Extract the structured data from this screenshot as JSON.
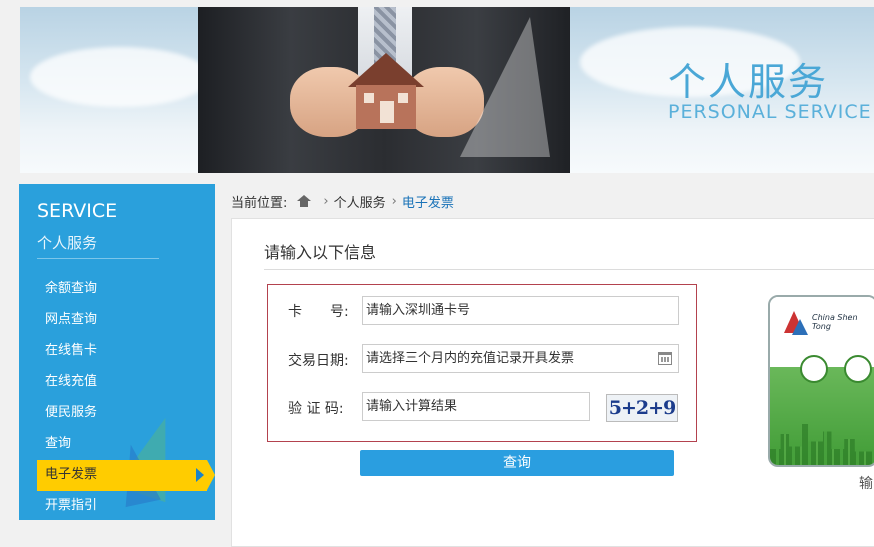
{
  "banner": {
    "title": "个人服务",
    "subtitle": "PERSONAL SERVICE"
  },
  "sidebar": {
    "heading": "SERVICE",
    "subheading": "个人服务",
    "items": [
      {
        "label": "余额查询"
      },
      {
        "label": "网点查询"
      },
      {
        "label": "在线售卡"
      },
      {
        "label": "在线充值"
      },
      {
        "label": "便民服务"
      },
      {
        "label": "查询"
      },
      {
        "label": "电子发票",
        "active": true
      },
      {
        "label": "开票指引"
      }
    ]
  },
  "breadcrumb": {
    "prefix": "当前位置:",
    "items": [
      "个人服务",
      "电子发票"
    ]
  },
  "form": {
    "title": "请输入以下信息",
    "card_label": "卡　　号:",
    "card_placeholder": "请输入深圳通卡号",
    "date_label": "交易日期:",
    "date_placeholder": "请选择三个月内的充值记录开具发票",
    "captcha_label": "验 证 码:",
    "captcha_placeholder": "请输入计算结果",
    "captcha_text": "5+2+9",
    "submit_label": "查询"
  },
  "card": {
    "brand_text": "China Shen Tong",
    "note": "输"
  }
}
